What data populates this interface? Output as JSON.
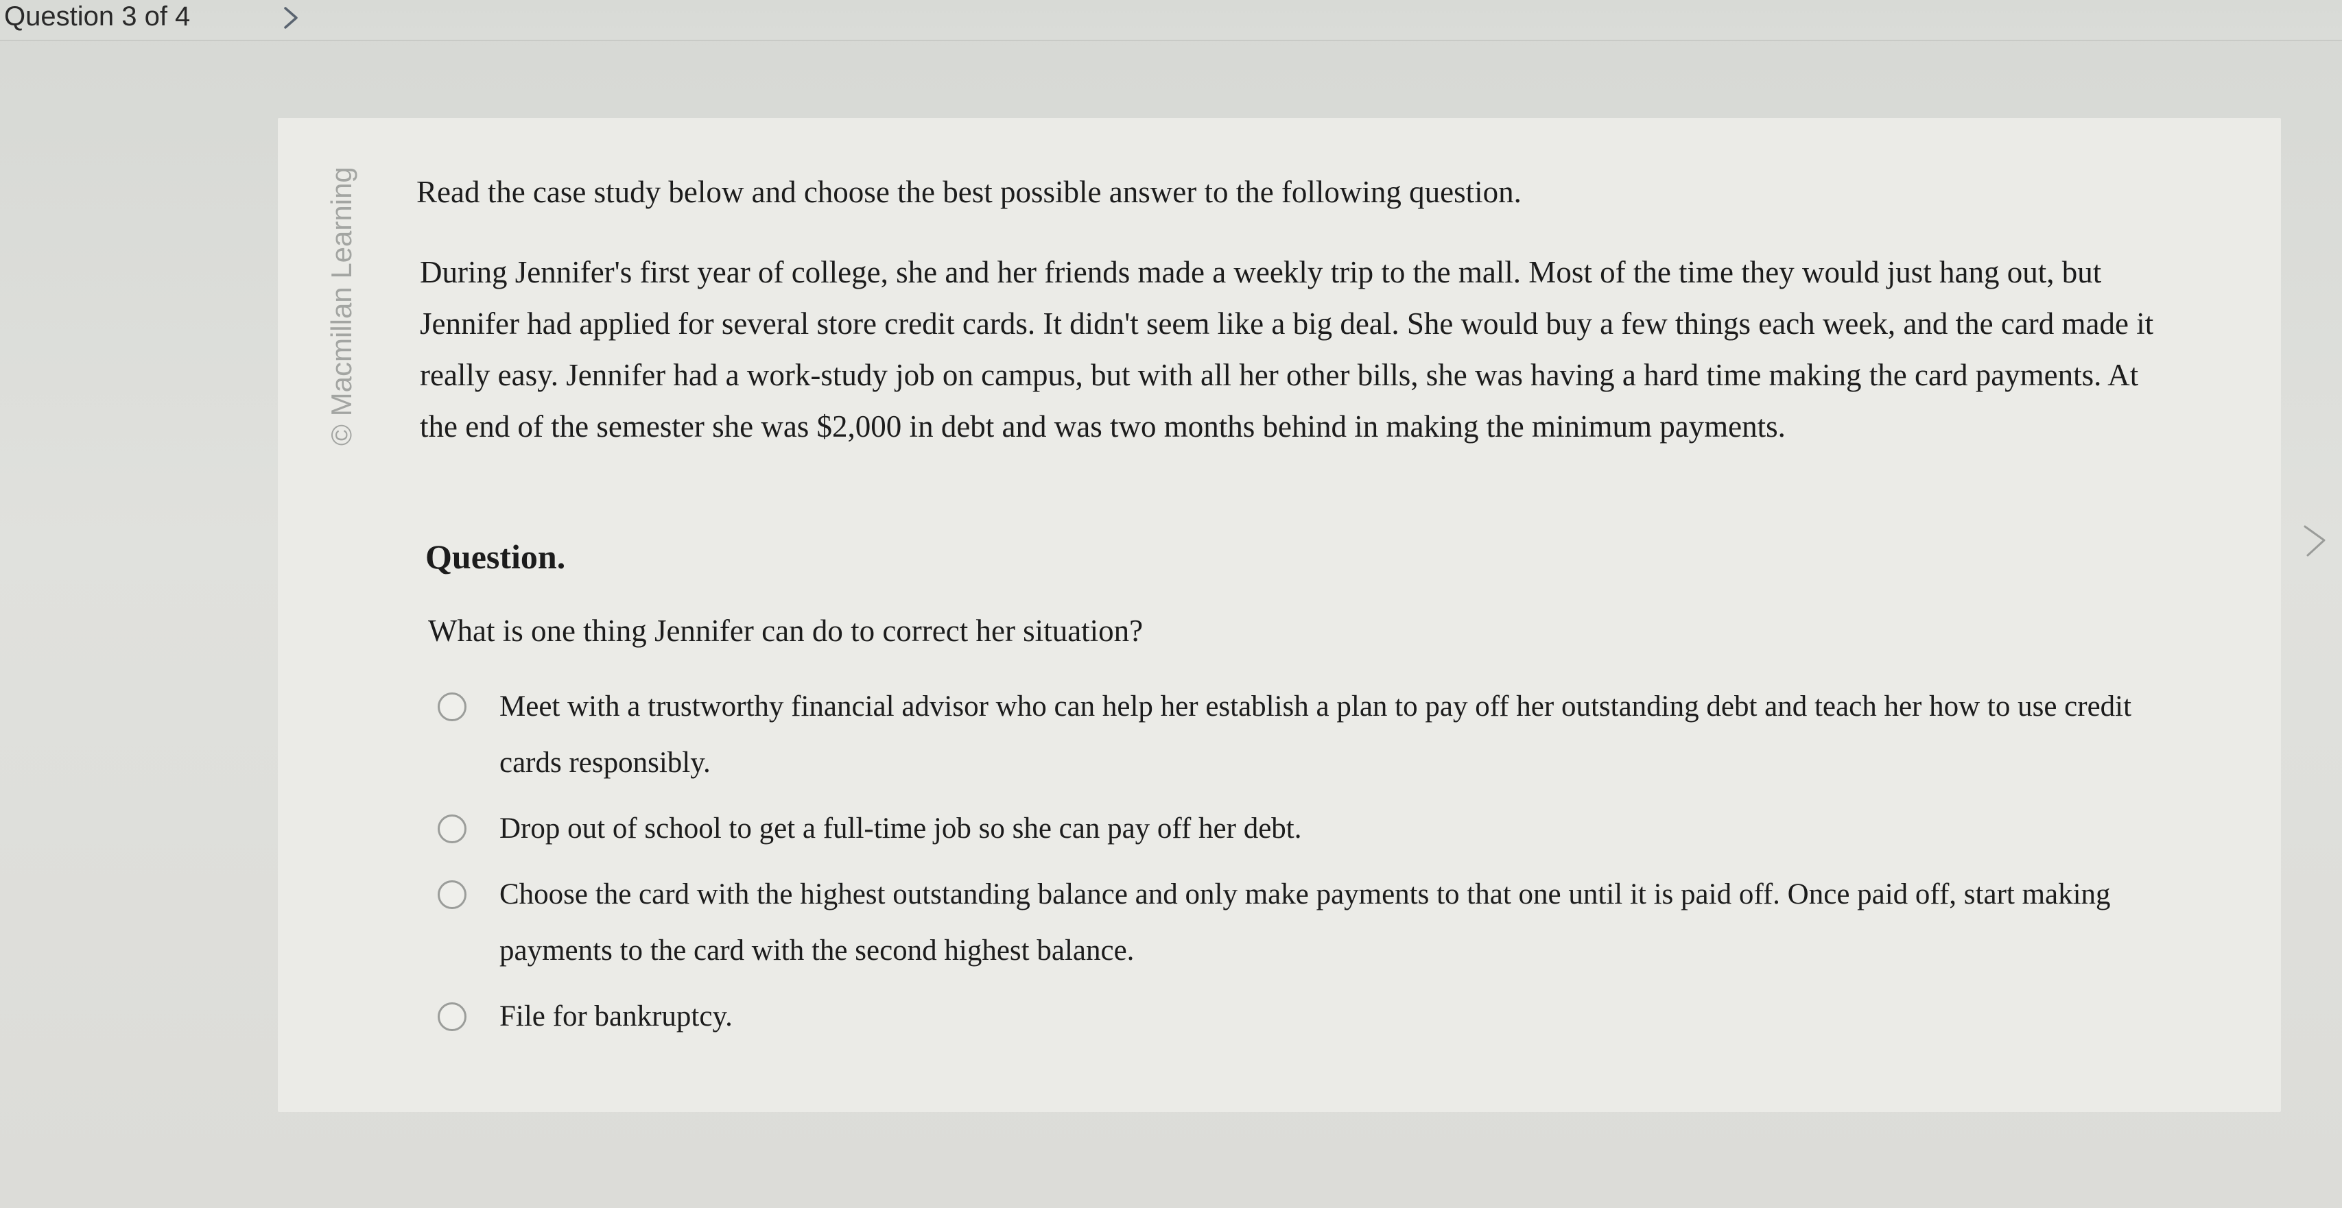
{
  "header": {
    "question_counter": "Question 3 of 4",
    "next_icon": "chevron-right-icon"
  },
  "watermark": {
    "text": "© Macmillan Learning"
  },
  "content": {
    "instruction": "Read the case study below and choose the best possible answer to the following question.",
    "case_study": "During Jennifer's first year of college, she and her friends made a weekly trip to the mall. Most of the time they would just hang out, but Jennifer had applied for several store credit cards. It didn't seem like a big deal. She would buy a few things each week, and the card made it really easy. Jennifer had a work-study job on campus, but with all her other bills, she was having a hard time making the card payments. At the end of the semester she was $2,000 in debt and was two months behind in making the minimum payments.",
    "question_heading": "Question.",
    "question_text": "What is one thing Jennifer can do to correct her situation?",
    "options": [
      {
        "label": "Meet with a trustworthy financial advisor who can help her establish a plan to pay off her outstanding debt and teach her how to use credit cards responsibly."
      },
      {
        "label": "Drop out of school to get a full-time job so she can pay off her debt."
      },
      {
        "label": "Choose the card with the highest outstanding balance and only make payments to that one until it is paid off. Once paid off, start making payments to the card with the second highest balance."
      },
      {
        "label": "File for bankruptcy."
      }
    ]
  }
}
